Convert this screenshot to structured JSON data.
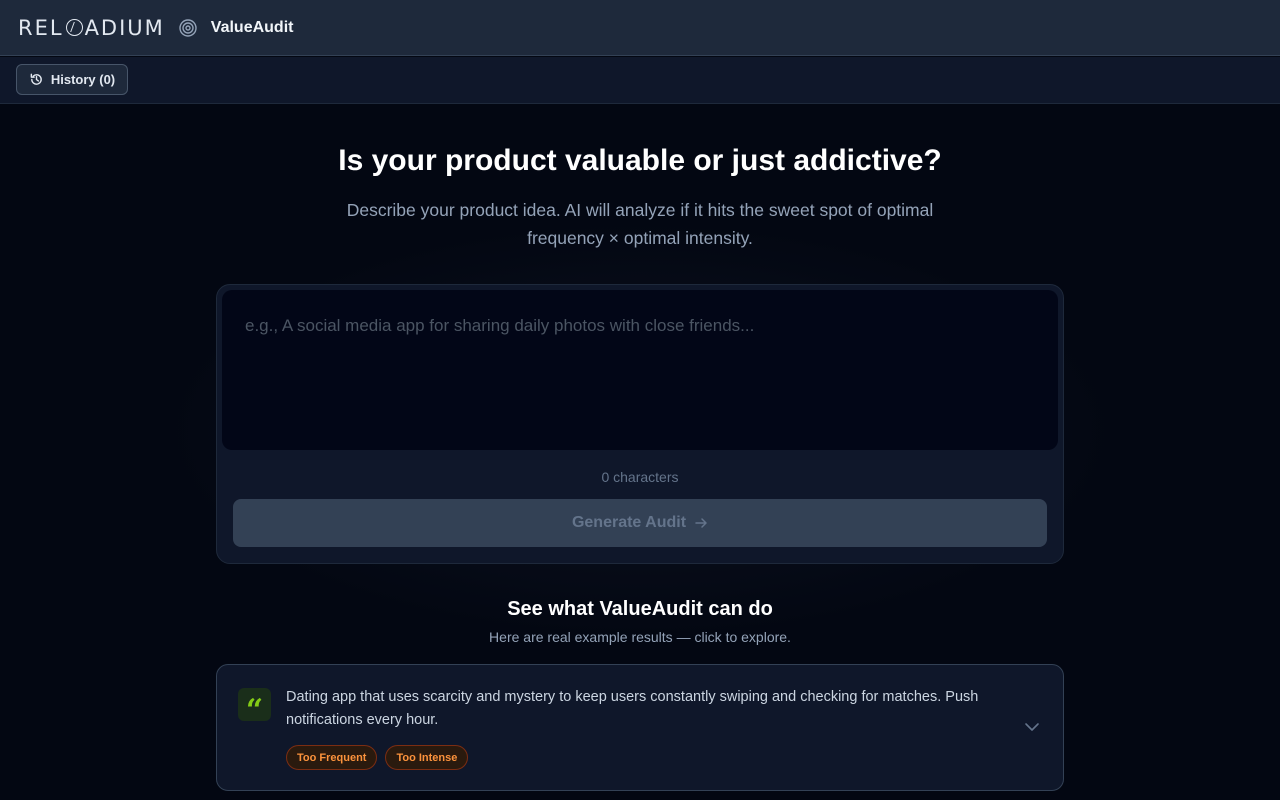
{
  "header": {
    "brand": "RELOADIUM",
    "app_name": "ValueAudit"
  },
  "subbar": {
    "history_label": "History (0)"
  },
  "hero": {
    "title": "Is your product valuable or just addictive?",
    "subtitle": "Describe your product idea. AI will analyze if it hits the sweet spot of optimal frequency × optimal intensity."
  },
  "input": {
    "value": "",
    "placeholder": "e.g., A social media app for sharing daily photos with close friends...",
    "char_count": "0 characters",
    "generate_label": "Generate Audit"
  },
  "examples": {
    "title": "See what ValueAudit can do",
    "subtitle": "Here are real example results — click to explore.",
    "items": [
      {
        "text": "Dating app that uses scarcity and mystery to keep users constantly swiping and checking for matches. Push notifications every hour.",
        "tags": [
          "Too Frequent",
          "Too Intense"
        ]
      }
    ]
  },
  "colors": {
    "background": "#030712",
    "accent_green": "#84cc16",
    "tag_orange": "#fb923c"
  },
  "icons": {
    "history": "history-icon",
    "target": "target-icon",
    "arrow": "arrow-right-icon",
    "quote": "quote-icon",
    "chevron": "chevron-down-icon"
  }
}
